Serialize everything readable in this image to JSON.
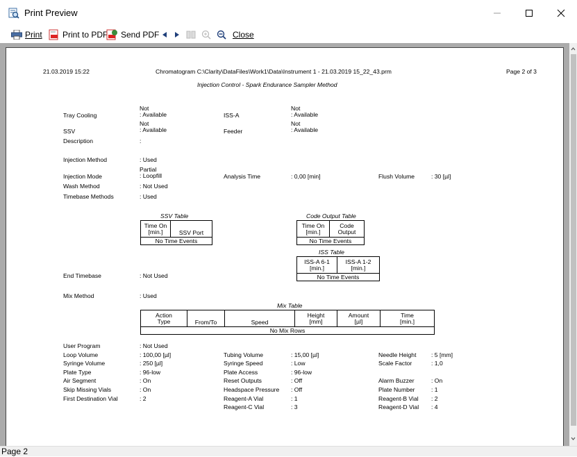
{
  "window": {
    "title": "Print Preview"
  },
  "toolbar": {
    "print": "Print",
    "print_to_pdf": "Print to PDF",
    "send_pdf": "Send PDF",
    "close": "Close"
  },
  "status": {
    "page": "Page 2"
  },
  "report": {
    "date": "21.03.2019   15:22",
    "chromatogram": "Chromatogram C:\\Clarity\\DataFiles\\Work1\\Data\\Instrument  1 - 21.03.2019  15_22_43.prm",
    "page_of": "Page 2 of 3",
    "subtitle": "Injection Control - Spark Endurance Sampler Method",
    "labels": {
      "tray_cooling": "Tray Cooling",
      "ssv": "SSV",
      "description": "Description",
      "iss_a": "ISS-A",
      "feeder": "Feeder",
      "injection_method": "Injection Method",
      "injection_mode": "Injection Mode",
      "wash_method": "Wash Method",
      "timebase_methods": "Timebase Methods",
      "analysis_time": "Analysis Time",
      "flush_volume": "Flush Volume",
      "end_timebase": "End Timebase",
      "mix_method": "Mix Method"
    },
    "values": {
      "tray_cooling_1": "Not",
      "tray_cooling_2": ": Available",
      "ssv_1": "Not",
      "ssv_2": ": Available",
      "description": ":",
      "iss_a_1": "Not",
      "iss_a_2": ": Available",
      "feeder_1": "Not",
      "feeder_2": ": Available",
      "injection_method": ": Used",
      "injection_mode_1": "Partial",
      "injection_mode_2": ": Loopfill",
      "wash_method": ": Not Used",
      "timebase_methods": ": Used",
      "analysis_time": ": 0,00 [min]",
      "flush_volume": ": 30 [µl]",
      "end_timebase": ": Not Used",
      "mix_method": ": Used"
    },
    "ssv_table": {
      "title": "SSV Table",
      "col1_l1": "Time On",
      "col1_l2": "[min.]",
      "col2": "SSV Port",
      "empty": "No Time Events"
    },
    "code_table": {
      "title": "Code Output Table",
      "col1_l1": "Time On",
      "col1_l2": "[min.]",
      "col2_l1": "Code",
      "col2_l2": "Output",
      "empty": "No Time Events"
    },
    "iss_table": {
      "title": "ISS Table",
      "col1_l1": "ISS-A 6-1",
      "col1_l2": "[min.]",
      "col2_l1": "ISS-A 1-2",
      "col2_l2": "[min.]",
      "empty": "No Time Events"
    },
    "mix_table": {
      "title": "Mix Table",
      "c1_l1": "Action",
      "c1_l2": "Type",
      "c2": "From/To",
      "c3": "Speed",
      "c4_l1": "Height",
      "c4_l2": "[mm]",
      "c5_l1": "Amount",
      "c5_l2": "[µl]",
      "c6_l1": "Time",
      "c6_l2": "[min.]",
      "empty": "No Mix Rows"
    },
    "settings": [
      [
        "User Program",
        ": Not Used",
        "",
        "",
        "",
        ""
      ],
      [
        "Loop Volume",
        ": 100,00 [µl]",
        "Tubing Volume",
        ": 15,00 [µl]",
        "Needle Height",
        ": 5 [mm]"
      ],
      [
        "Syringe Volume",
        ": 250 [µl]",
        "Syringe Speed",
        ": Low",
        "Scale Factor",
        ": 1,0"
      ],
      [
        "Plate Type",
        ": 96-low",
        "Plate Access",
        ": 96-low",
        "",
        ""
      ],
      [
        "Air Segment",
        ": On",
        "Reset Outputs",
        ": Off",
        "Alarm Buzzer",
        ": On"
      ],
      [
        "Skip Missing Vials",
        ": On",
        "Headspace Pressure",
        ": Off",
        "Plate Number",
        ": 1"
      ],
      [
        "First Destination Vial",
        ": 2",
        "Reagent-A Vial",
        ": 1",
        "Reagent-B Vial",
        ": 2"
      ],
      [
        "",
        "",
        "Reagent-C Vial",
        ": 3",
        "Reagent-D Vial",
        ": 4"
      ]
    ]
  }
}
